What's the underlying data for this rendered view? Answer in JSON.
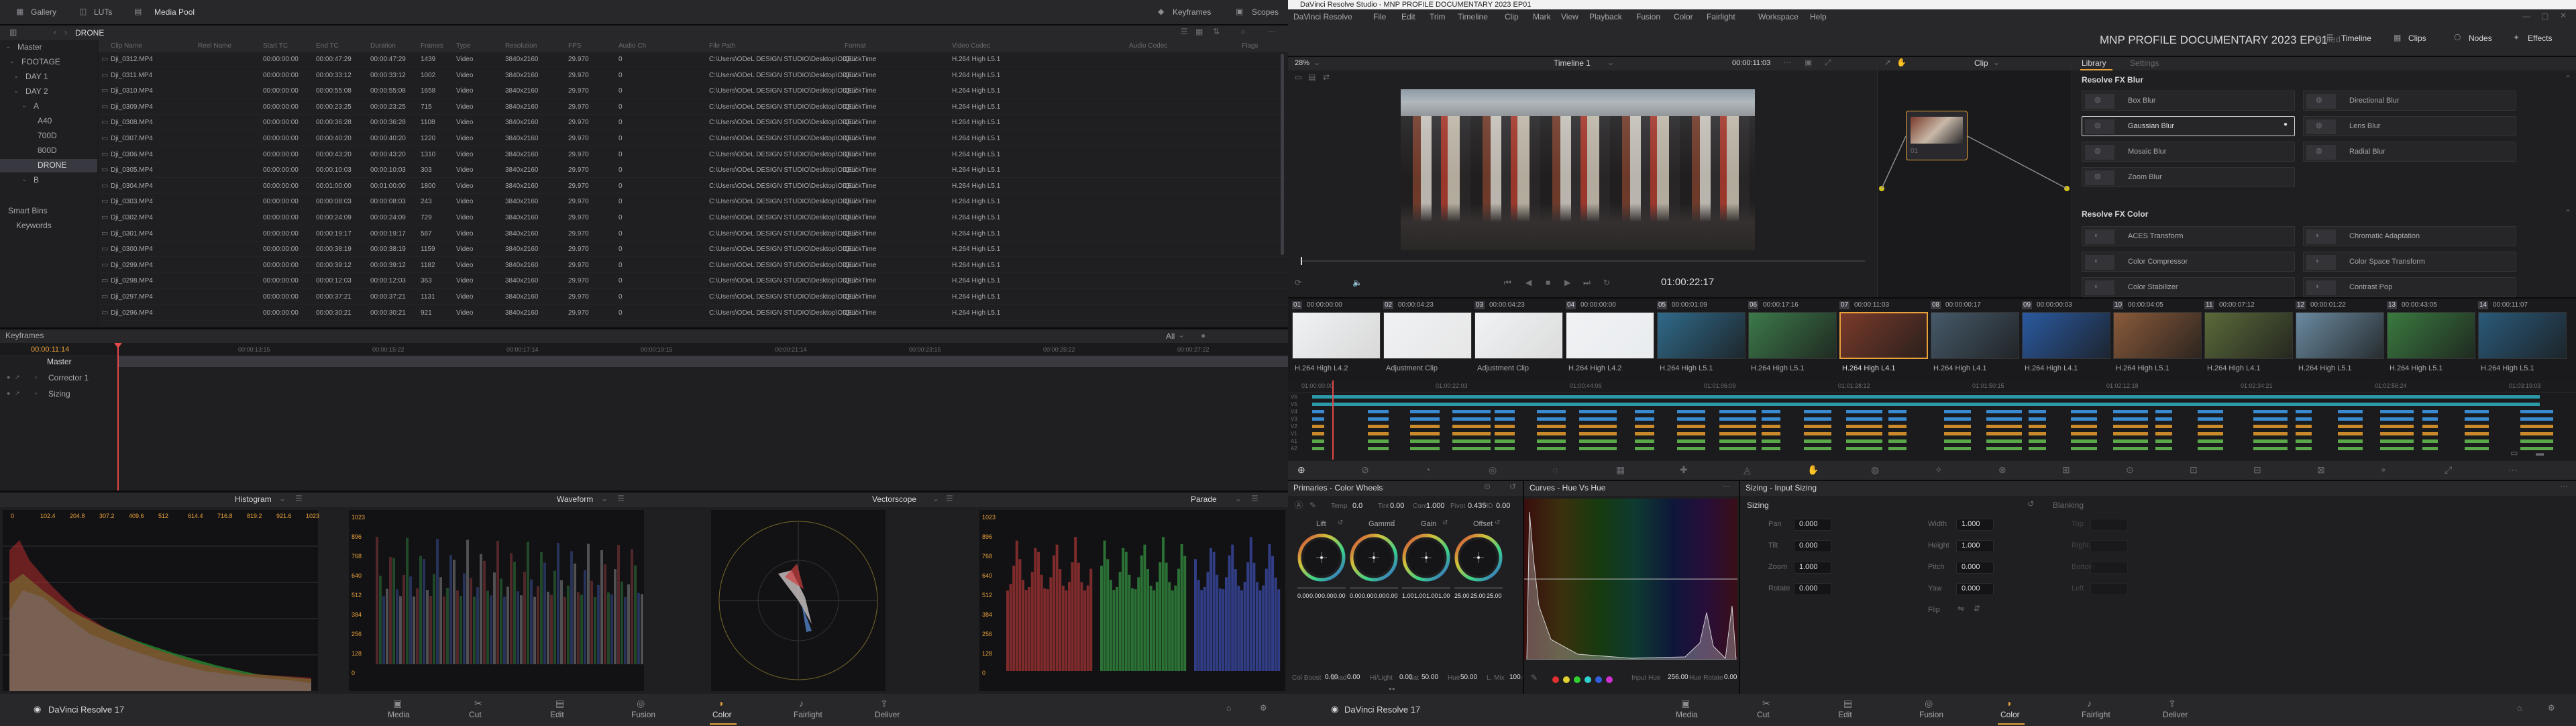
{
  "left": {
    "toolbar": {
      "gallery": "Gallery",
      "luts": "LUTs",
      "media_pool": "Media Pool",
      "keyframes": "Keyframes",
      "scopes": "Scopes"
    },
    "bin_path": "DRONE",
    "bins": [
      "Master",
      "FOOTAGE",
      "DAY 1",
      "DAY 2",
      "A",
      "A40",
      "700D",
      "800D",
      "DRONE",
      "B",
      "Smart Bins",
      "Keywords"
    ],
    "columns": [
      "Clip Name",
      "Reel Name",
      "Start TC",
      "End TC",
      "Duration",
      "Frames",
      "Type",
      "Resolution",
      "FPS",
      "Audio Ch",
      "File Path",
      "Format",
      "Video Codec",
      "Audio Codec",
      "Flags"
    ],
    "clips": [
      [
        "Dji_0312.MP4",
        "",
        "00:00:00:00",
        "00:00:47:29",
        "00:00:47:29",
        "1439",
        "Video",
        "3840x2160",
        "29.970",
        "0",
        "C:\\Users\\ODeL DESIGN STUDIO\\Desktop\\ODEL\\M...",
        "QuickTime",
        "H.264 High L5.1"
      ],
      [
        "Dji_0311.MP4",
        "",
        "00:00:00:00",
        "00:00:33:12",
        "00:00:33:12",
        "1002",
        "Video",
        "3840x2160",
        "29.970",
        "0",
        "C:\\Users\\ODeL DESIGN STUDIO\\Desktop\\ODEL\\M...",
        "QuickTime",
        "H.264 High L5.1"
      ],
      [
        "Dji_0310.MP4",
        "",
        "00:00:00:00",
        "00:00:55:08",
        "00:00:55:08",
        "1658",
        "Video",
        "3840x2160",
        "29.970",
        "0",
        "C:\\Users\\ODeL DESIGN STUDIO\\Desktop\\ODEL\\M...",
        "QuickTime",
        "H.264 High L5.1"
      ],
      [
        "Dji_0309.MP4",
        "",
        "00:00:00:00",
        "00:00:23:25",
        "00:00:23:25",
        "715",
        "Video",
        "3840x2160",
        "29.970",
        "0",
        "C:\\Users\\ODeL DESIGN STUDIO\\Desktop\\ODEL\\M...",
        "QuickTime",
        "H.264 High L5.1"
      ],
      [
        "Dji_0308.MP4",
        "",
        "00:00:00:00",
        "00:00:36:28",
        "00:00:36:28",
        "1108",
        "Video",
        "3840x2160",
        "29.970",
        "0",
        "C:\\Users\\ODeL DESIGN STUDIO\\Desktop\\ODEL\\M...",
        "QuickTime",
        "H.264 High L5.1"
      ],
      [
        "Dji_0307.MP4",
        "",
        "00:00:00:00",
        "00:00:40:20",
        "00:00:40:20",
        "1220",
        "Video",
        "3840x2160",
        "29.970",
        "0",
        "C:\\Users\\ODeL DESIGN STUDIO\\Desktop\\ODEL\\M...",
        "QuickTime",
        "H.264 High L5.1"
      ],
      [
        "Dji_0306.MP4",
        "",
        "00:00:00:00",
        "00:00:43:20",
        "00:00:43:20",
        "1310",
        "Video",
        "3840x2160",
        "29.970",
        "0",
        "C:\\Users\\ODeL DESIGN STUDIO\\Desktop\\ODEL\\M...",
        "QuickTime",
        "H.264 High L5.1"
      ],
      [
        "Dji_0305.MP4",
        "",
        "00:00:00:00",
        "00:00:10:03",
        "00:00:10:03",
        "303",
        "Video",
        "3840x2160",
        "29.970",
        "0",
        "C:\\Users\\ODeL DESIGN STUDIO\\Desktop\\ODEL\\M...",
        "QuickTime",
        "H.264 High L5.1"
      ],
      [
        "Dji_0304.MP4",
        "",
        "00:00:00:00",
        "00:01:00:00",
        "00:01:00:00",
        "1800",
        "Video",
        "3840x2160",
        "29.970",
        "0",
        "C:\\Users\\ODeL DESIGN STUDIO\\Desktop\\ODEL\\M...",
        "QuickTime",
        "H.264 High L5.1"
      ],
      [
        "Dji_0303.MP4",
        "",
        "00:00:00:00",
        "00:00:08:03",
        "00:00:08:03",
        "243",
        "Video",
        "3840x2160",
        "29.970",
        "0",
        "C:\\Users\\ODeL DESIGN STUDIO\\Desktop\\ODEL\\M...",
        "QuickTime",
        "H.264 High L5.1"
      ],
      [
        "Dji_0302.MP4",
        "",
        "00:00:00:00",
        "00:00:24:09",
        "00:00:24:09",
        "729",
        "Video",
        "3840x2160",
        "29.970",
        "0",
        "C:\\Users\\ODeL DESIGN STUDIO\\Desktop\\ODEL\\M...",
        "QuickTime",
        "H.264 High L5.1"
      ],
      [
        "Dji_0301.MP4",
        "",
        "00:00:00:00",
        "00:00:19:17",
        "00:00:19:17",
        "587",
        "Video",
        "3840x2160",
        "29.970",
        "0",
        "C:\\Users\\ODeL DESIGN STUDIO\\Desktop\\ODEL\\M...",
        "QuickTime",
        "H.264 High L5.1"
      ],
      [
        "Dji_0300.MP4",
        "",
        "00:00:00:00",
        "00:00:38:19",
        "00:00:38:19",
        "1159",
        "Video",
        "3840x2160",
        "29.970",
        "0",
        "C:\\Users\\ODeL DESIGN STUDIO\\Desktop\\ODEL\\M...",
        "QuickTime",
        "H.264 High L5.1"
      ],
      [
        "Dji_0299.MP4",
        "",
        "00:00:00:00",
        "00:00:39:12",
        "00:00:39:12",
        "1182",
        "Video",
        "3840x2160",
        "29.970",
        "0",
        "C:\\Users\\ODeL DESIGN STUDIO\\Desktop\\ODEL\\M...",
        "QuickTime",
        "H.264 High L5.1"
      ],
      [
        "Dji_0298.MP4",
        "",
        "00:00:00:00",
        "00:00:12:03",
        "00:00:12:03",
        "363",
        "Video",
        "3840x2160",
        "29.970",
        "0",
        "C:\\Users\\ODeL DESIGN STUDIO\\Desktop\\ODEL\\M...",
        "QuickTime",
        "H.264 High L5.1"
      ],
      [
        "Dji_0297.MP4",
        "",
        "00:00:00:00",
        "00:00:37:21",
        "00:00:37:21",
        "1131",
        "Video",
        "3840x2160",
        "29.970",
        "0",
        "C:\\Users\\ODeL DESIGN STUDIO\\Desktop\\ODEL\\M...",
        "QuickTime",
        "H.264 High L5.1"
      ],
      [
        "Dji_0296.MP4",
        "",
        "00:00:00:00",
        "00:00:30:21",
        "00:00:30:21",
        "921",
        "Video",
        "3840x2160",
        "29.970",
        "0",
        "C:\\Users\\ODeL DESIGN STUDIO\\Desktop\\ODEL\\M...",
        "QuickTime",
        "H.264 High L5.1"
      ]
    ],
    "keyframes": {
      "title": "Keyframes",
      "filter": "All",
      "current_tc": "00:00:11:14",
      "ruler": [
        "00:00:11:14",
        "00:00:13:15",
        "00:00:15:22",
        "00:00:17:14",
        "00:00:19:15",
        "00:00:21:14",
        "00:00:23:15",
        "00:00:25:22",
        "00:00:27:22"
      ],
      "tracks": [
        "Master",
        "Corrector 1",
        "Sizing"
      ]
    },
    "scopes": {
      "histogram": "Histogram",
      "waveform": "Waveform",
      "vectorscope": "Vectorscope",
      "parade": "Parade",
      "hist_ticks": [
        "0",
        "102.4",
        "204.8",
        "307.2",
        "409.6",
        "512",
        "614.4",
        "716.8",
        "819.2",
        "921.6",
        "1023"
      ],
      "wave_ticks": [
        "1023",
        "896",
        "768",
        "640",
        "512",
        "384",
        "256",
        "128",
        "0"
      ],
      "parade_ticks": [
        "1023",
        "896",
        "768",
        "640",
        "512",
        "384",
        "256",
        "128",
        "0"
      ]
    },
    "brand": "DaVinci Resolve 17"
  },
  "app": {
    "title": "DaVinci Resolve Studio - MNP PROFILE DOCUMENTARY 2023 EP01",
    "menu": [
      "DaVinci Resolve",
      "File",
      "Edit",
      "Trim",
      "Timeline",
      "Clip",
      "Mark",
      "View",
      "Playback",
      "Fusion",
      "Color",
      "Fairlight",
      "Workspace",
      "Help"
    ],
    "project": "MNP PROFILE DOCUMENTARY 2023 EP01",
    "status": "Edited",
    "top_right": [
      "Timeline",
      "Clips",
      "Nodes",
      "Effects"
    ]
  },
  "viewer": {
    "zoom": "28%",
    "timeline": "Timeline 1",
    "source_tc": "00:00:11:03",
    "clip_menu": "Clip",
    "playhead_tc": "01:00:22:17"
  },
  "library": {
    "tabs": [
      "Library",
      "Settings"
    ],
    "blur_title": "Resolve FX Blur",
    "blur": [
      "Box Blur",
      "Directional Blur",
      "Gaussian Blur",
      "Lens Blur",
      "Mosaic Blur",
      "Radial Blur",
      "Zoom Blur"
    ],
    "color_title": "Resolve FX Color",
    "color": [
      "ACES Transform",
      "Chromatic Adaptation",
      "Color Compressor",
      "Color Space Transform",
      "Color Stabilizer",
      "Contrast Pop"
    ]
  },
  "clips_strip": [
    {
      "num": "01",
      "tc": "00:00:00:00",
      "v": "V1",
      "codec": "H.264 High L4.2"
    },
    {
      "num": "02",
      "tc": "00:00:04:23",
      "v": "V1",
      "codec": "Adjustment Clip"
    },
    {
      "num": "03",
      "tc": "00:00:04:23",
      "v": "V2",
      "codec": "Adjustment Clip"
    },
    {
      "num": "04",
      "tc": "00:00:00:00",
      "v": "V1",
      "codec": "H.264 High L4.2"
    },
    {
      "num": "05",
      "tc": "00:00:01:09",
      "v": "V1",
      "codec": "H.264 High L5.1"
    },
    {
      "num": "06",
      "tc": "00:00:17:16",
      "v": "V1",
      "codec": "H.264 High L5.1"
    },
    {
      "num": "07",
      "tc": "00:00:11:03",
      "v": "V1",
      "codec": "H.264 High L4.1"
    },
    {
      "num": "08",
      "tc": "00:00:00:17",
      "v": "V1",
      "codec": "H.264 High L4.1"
    },
    {
      "num": "09",
      "tc": "00:00:00:03",
      "v": "V1",
      "codec": "H.264 High L4.1"
    },
    {
      "num": "10",
      "tc": "00:00:04:05",
      "v": "V1",
      "codec": "H.264 High L5.1"
    },
    {
      "num": "11",
      "tc": "00:00:07:12",
      "v": "V1",
      "codec": "H.264 High L4.1"
    },
    {
      "num": "12",
      "tc": "00:00:01:22",
      "v": "V1",
      "codec": "H.264 High L5.1"
    },
    {
      "num": "13",
      "tc": "00:00:43:05",
      "v": "V1",
      "codec": "H.264 High L5.1"
    },
    {
      "num": "14",
      "tc": "00:00:11:07",
      "v": "V1",
      "codec": "H.264 High L5.1"
    }
  ],
  "mini_timeline": {
    "ruler": [
      "01:00:00:00",
      "01:00:22:03",
      "01:00:44:06",
      "01:01:06:09",
      "01:01:28:12",
      "01:01:50:15",
      "01:02:12:18",
      "01:02:34:21",
      "01:02:56:24",
      "01:03:19:03"
    ],
    "tracks": [
      "V6",
      "V5",
      "V4",
      "V3",
      "V2",
      "V1",
      "A1",
      "A2"
    ]
  },
  "primaries": {
    "title": "Primaries - Color Wheels",
    "temp_l": "Temp",
    "temp": "0.0",
    "tint_l": "Tint",
    "tint": "0.00",
    "cont_l": "Cont",
    "cont": "1.000",
    "pivot_l": "Pivot",
    "pivot": "0.435",
    "md_l": "MD",
    "md": "0.00",
    "wheels": [
      {
        "name": "Lift",
        "vals": [
          "0.00",
          "0.00",
          "0.00",
          "0.00"
        ]
      },
      {
        "name": "Gamma",
        "vals": [
          "0.00",
          "0.00",
          "0.00",
          "0.00"
        ]
      },
      {
        "name": "Gain",
        "vals": [
          "1.00",
          "1.00",
          "1.00",
          "1.00"
        ]
      },
      {
        "name": "Offset",
        "vals": [
          "25.00",
          "25.00",
          "25.00"
        ]
      }
    ],
    "bottom": [
      {
        "l": "Col Boost",
        "v": "0.00"
      },
      {
        "l": "Shad",
        "v": "0.00"
      },
      {
        "l": "Hi/Light",
        "v": "0.00"
      },
      {
        "l": "Sat",
        "v": "50.00"
      },
      {
        "l": "Hue",
        "v": "50.00"
      },
      {
        "l": "L. Mix",
        "v": "100.00"
      }
    ]
  },
  "curves": {
    "title": "Curves - Hue Vs Hue",
    "input_hue_l": "Input Hue",
    "input_hue": "256.00",
    "hue_rot_l": "Hue Rotate",
    "hue_rot": "0.00",
    "swatches": [
      "#e03030",
      "#e0d030",
      "#30d030",
      "#30d0d0",
      "#3060e0",
      "#d030d0"
    ]
  },
  "sizing": {
    "title": "Sizing - Input Sizing",
    "section": "Sizing",
    "blanking": "Blanking",
    "left": [
      {
        "l": "Pan",
        "v": "0.000"
      },
      {
        "l": "Tilt",
        "v": "0.000"
      },
      {
        "l": "Zoom",
        "v": "1.000"
      },
      {
        "l": "Rotate",
        "v": "0.000"
      }
    ],
    "right": [
      {
        "l": "Width",
        "v": "1.000"
      },
      {
        "l": "Height",
        "v": "1.000"
      },
      {
        "l": "Pitch",
        "v": "0.000"
      },
      {
        "l": "Yaw",
        "v": "0.000"
      },
      {
        "l": "Flip",
        "v": ""
      }
    ],
    "blank": [
      "Top",
      "Right",
      "Bottom",
      "Left"
    ]
  },
  "pages": [
    "Media",
    "Cut",
    "Edit",
    "Fusion",
    "Color",
    "Fairlight",
    "Deliver"
  ],
  "active_page": "Color",
  "colors": {
    "accent": "#e9a23b",
    "bg": "#1c1c1e",
    "panel": "#1f1f21"
  }
}
